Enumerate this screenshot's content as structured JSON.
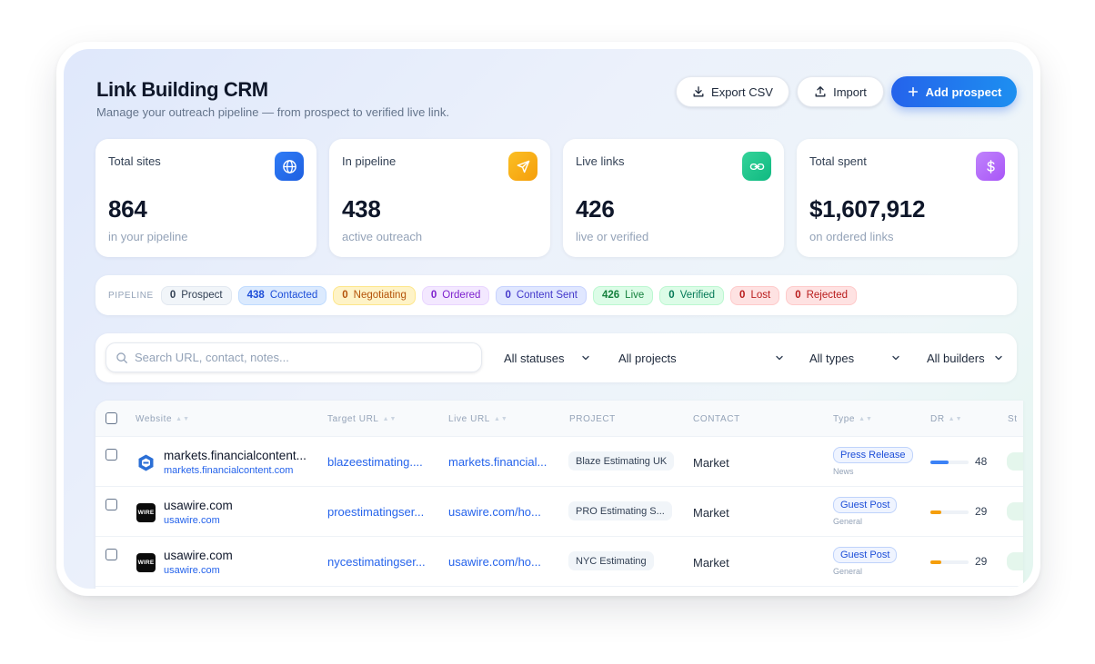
{
  "header": {
    "title": "Link Building CRM",
    "subtitle": "Manage your outreach pipeline — from prospect to verified live link.",
    "export_label": "Export CSV",
    "import_label": "Import",
    "add_label": "Add prospect"
  },
  "stats": [
    {
      "label": "Total sites",
      "value": "864",
      "sub": "in your pipeline",
      "icon": "globe-icon",
      "color": "#2563eb"
    },
    {
      "label": "In pipeline",
      "value": "438",
      "sub": "active outreach",
      "icon": "send-icon",
      "color": "#f59e0b"
    },
    {
      "label": "Live links",
      "value": "426",
      "sub": "live or verified",
      "icon": "link-icon",
      "color": "#10b981"
    },
    {
      "label": "Total spent",
      "value": "$1,607,912",
      "sub": "on ordered links",
      "icon": "dollar-icon",
      "color": "#a855f7"
    }
  ],
  "pipeline": {
    "label": "PIPELINE",
    "stages": [
      {
        "count": "0",
        "name": "Prospect",
        "bg": "#f1f5f9",
        "fg": "#334155"
      },
      {
        "count": "438",
        "name": "Contacted",
        "bg": "#dbeafe",
        "fg": "#1d4ed8"
      },
      {
        "count": "0",
        "name": "Negotiating",
        "bg": "#fef3c7",
        "fg": "#b45309"
      },
      {
        "count": "0",
        "name": "Ordered",
        "bg": "#f3e8ff",
        "fg": "#7e22ce"
      },
      {
        "count": "0",
        "name": "Content Sent",
        "bg": "#e0e7ff",
        "fg": "#4338ca"
      },
      {
        "count": "426",
        "name": "Live",
        "bg": "#dcfce7",
        "fg": "#15803d"
      },
      {
        "count": "0",
        "name": "Verified",
        "bg": "#dcfce7",
        "fg": "#047857"
      },
      {
        "count": "0",
        "name": "Lost",
        "bg": "#fee2e2",
        "fg": "#b91c1c"
      },
      {
        "count": "0",
        "name": "Rejected",
        "bg": "#fee2e2",
        "fg": "#b91c1c"
      }
    ]
  },
  "filters": {
    "search_placeholder": "Search URL, contact, notes...",
    "status": "All statuses",
    "project": "All projects",
    "type": "All types",
    "builder": "All builders"
  },
  "table": {
    "columns": [
      "Website",
      "Target URL",
      "Live URL",
      "PROJECT",
      "CONTACT",
      "Type",
      "DR",
      "St"
    ],
    "rows": [
      {
        "name": "markets.financialcontent...",
        "url": "markets.financialcontent.com",
        "favicon": "financialcontent-logo-icon",
        "target": "blazeestimating....",
        "live": "markets.financial...",
        "project": "Blaze Estimating UK",
        "contact": "Market",
        "type": "Press Release",
        "type_sub": "News",
        "dr": "48",
        "dr_color": "#3b82f6"
      },
      {
        "name": "usawire.com",
        "url": "usawire.com",
        "favicon": "wire-logo-icon",
        "favicon_text": "WIRE",
        "target": "proestimatingser...",
        "live": "usawire.com/ho...",
        "project": "PRO Estimating S...",
        "contact": "Market",
        "type": "Guest Post",
        "type_sub": "General",
        "dr": "29",
        "dr_color": "#f59e0b"
      },
      {
        "name": "usawire.com",
        "url": "usawire.com",
        "favicon": "wire-logo-icon",
        "favicon_text": "WIRE",
        "target": "nycestimatingser...",
        "live": "usawire.com/ho...",
        "project": "NYC Estimating",
        "contact": "Market",
        "type": "Guest Post",
        "type_sub": "General",
        "dr": "29",
        "dr_color": "#f59e0b"
      }
    ]
  }
}
